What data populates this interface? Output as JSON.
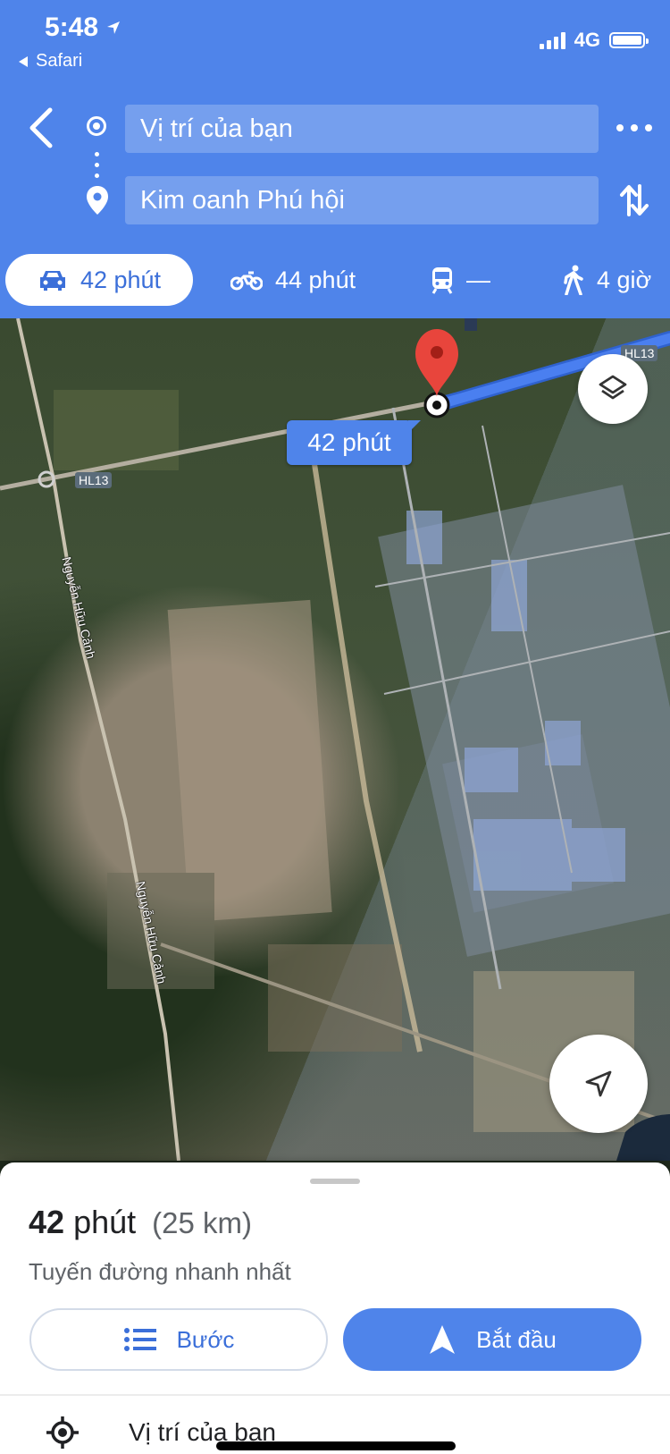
{
  "status_bar": {
    "time": "5:48",
    "back_app": "Safari",
    "network": "4G"
  },
  "header": {
    "origin_field": "Vị trí của bạn",
    "destination_field": "Kim oanh Phú hội"
  },
  "modes": [
    {
      "name": "car",
      "label": "42 phút",
      "selected": true
    },
    {
      "name": "motorbike",
      "label": "44 phút",
      "selected": false
    },
    {
      "name": "transit",
      "label": "—",
      "selected": false
    },
    {
      "name": "walk",
      "label": "4 giờ",
      "selected": false
    }
  ],
  "map": {
    "route_label": "42 phút",
    "road_labels": {
      "hl13": "HL13",
      "hl13_right": "HL13",
      "nguyen_huu_canh_1": "Nguyễn Hữu Cảnh",
      "nguyen_huu_canh_2": "Nguyễn Hữu Cảnh"
    }
  },
  "sheet": {
    "duration": "42 phút",
    "duration_number": "42",
    "duration_unit": "phút",
    "distance": "(25 km)",
    "subtitle": "Tuyến đường nhanh nhất",
    "steps_button": "Bước",
    "start_button": "Bắt đầu",
    "first_step": "Vị trí của bạn"
  },
  "colors": {
    "accent": "#4f84ea",
    "route": "#4a7ff0",
    "pin": "#e8453c"
  }
}
